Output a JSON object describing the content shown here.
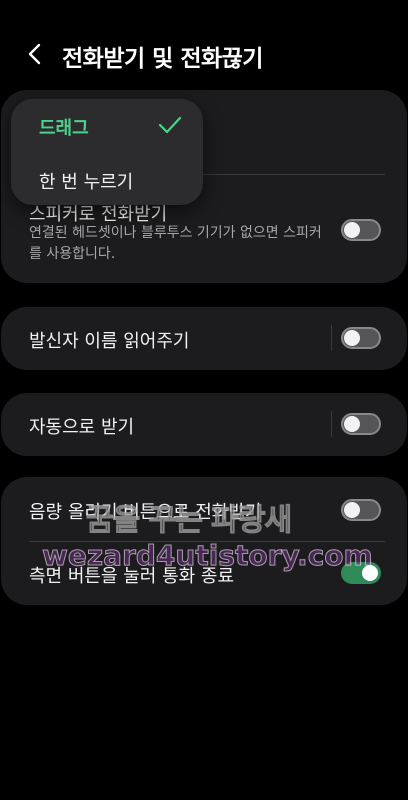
{
  "header": {
    "title": "전화받기 및 전화끊기"
  },
  "popup": {
    "options": [
      {
        "label": "드래그",
        "selected": true
      },
      {
        "label": "한 번 누르기",
        "selected": false
      }
    ]
  },
  "card1": {
    "speaker_title": "스피커로 전화받기",
    "speaker_sub": "연결된 헤드셋이나 블루투스 기기가 없으면 스피커를 사용합니다.",
    "speaker_on": false
  },
  "caller_name": {
    "label": "발신자 이름 읽어주기",
    "on": false
  },
  "auto_answer": {
    "label": "자동으로 받기",
    "on": false
  },
  "card4": {
    "volume_key": {
      "label": "음량 올리기 버튼으로 전화받기",
      "on": false
    },
    "side_key": {
      "label": "측면 버튼을 눌러 통화 종료",
      "on": true
    }
  },
  "watermark": {
    "line1": "꿈을 꾸는 파랑새",
    "line2": "wezard4utistory.com"
  },
  "colors": {
    "accent_green": "#4ed28a",
    "toggle_on": "#2e8b57",
    "card_bg": "#1c1c1e"
  }
}
